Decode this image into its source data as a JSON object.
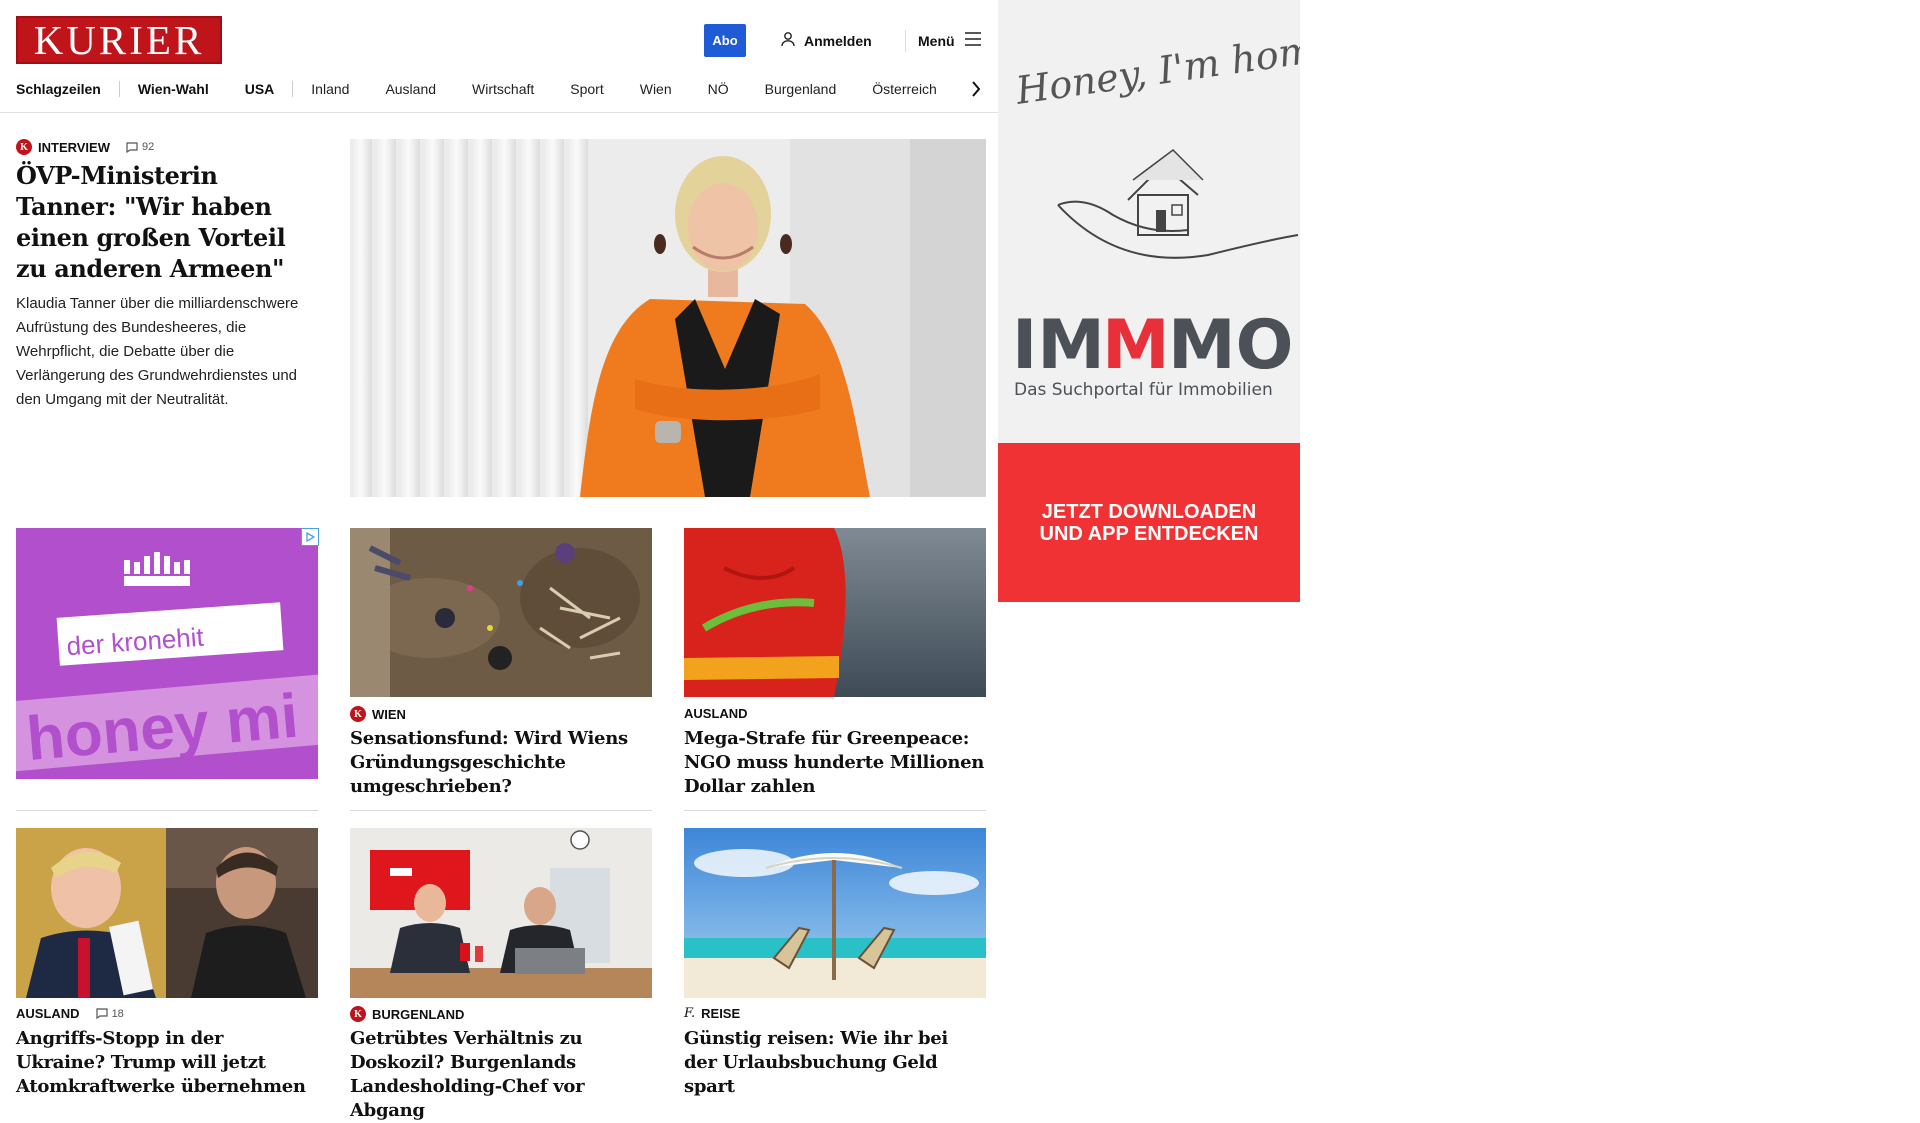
{
  "header": {
    "logo": "KURIER",
    "abo_label": "Abo",
    "login_label": "Anmelden",
    "menu_label": "Menü",
    "accent": "#c0141b"
  },
  "nav": {
    "items": [
      "Schlagzeilen",
      "Wien-Wahl",
      "USA",
      "Inland",
      "Ausland",
      "Wirtschaft",
      "Sport",
      "Wien",
      "NÖ",
      "Burgenland",
      "Österreich"
    ]
  },
  "lead": {
    "category": "INTERVIEW",
    "comments": "92",
    "title": "ÖVP-Ministerin Tanner: \"Wir haben einen großen Vorteil zu anderen Armeen\"",
    "text": "Klaudia Tanner über die milliardenschwere Aufrüstung des Bundesheeres, die Wehrpflicht, die Debatte über die Verlängerung des Grundwehrdienstes und den Umgang mit der Neutralität."
  },
  "ad_left": {
    "brand": "der kronehit",
    "slogan": "honey mi"
  },
  "cards": [
    {
      "category": "WIEN",
      "badge": "K",
      "title": "Sensationsfund: Wird Wiens Gründungsgeschichte umgeschrieben?",
      "comments": ""
    },
    {
      "category": "AUSLAND",
      "badge": "",
      "title": "Mega-Strafe für Greenpeace: NGO muss hunderte Millionen Dollar zahlen",
      "comments": ""
    },
    {
      "category": "AUSLAND",
      "badge": "",
      "title": "Angriffs-Stopp in der Ukraine? Trump will jetzt Atomkraftwerke übernehmen",
      "comments": "18"
    },
    {
      "category": "BURGENLAND",
      "badge": "K",
      "title": "Getrübtes Verhältnis zu Doskozil? Burgenlands Landesholding-Chef vor Abgang",
      "comments": ""
    },
    {
      "category": "REISE",
      "badge": "f.",
      "title": "Günstig reisen: Wie ihr bei der Urlaubsbuchung Geld spart",
      "comments": ""
    }
  ],
  "ad_right": {
    "script": "Honey, I'm home!",
    "brand_a": "IM",
    "brand_b": "M",
    "brand_c": "MO",
    "subtitle": "Das Suchportal für Immobilien",
    "cta_line1": "JETZT DOWNLOADEN",
    "cta_line2": "UND APP ENTDECKEN",
    "brand_red": "#e8303a"
  }
}
